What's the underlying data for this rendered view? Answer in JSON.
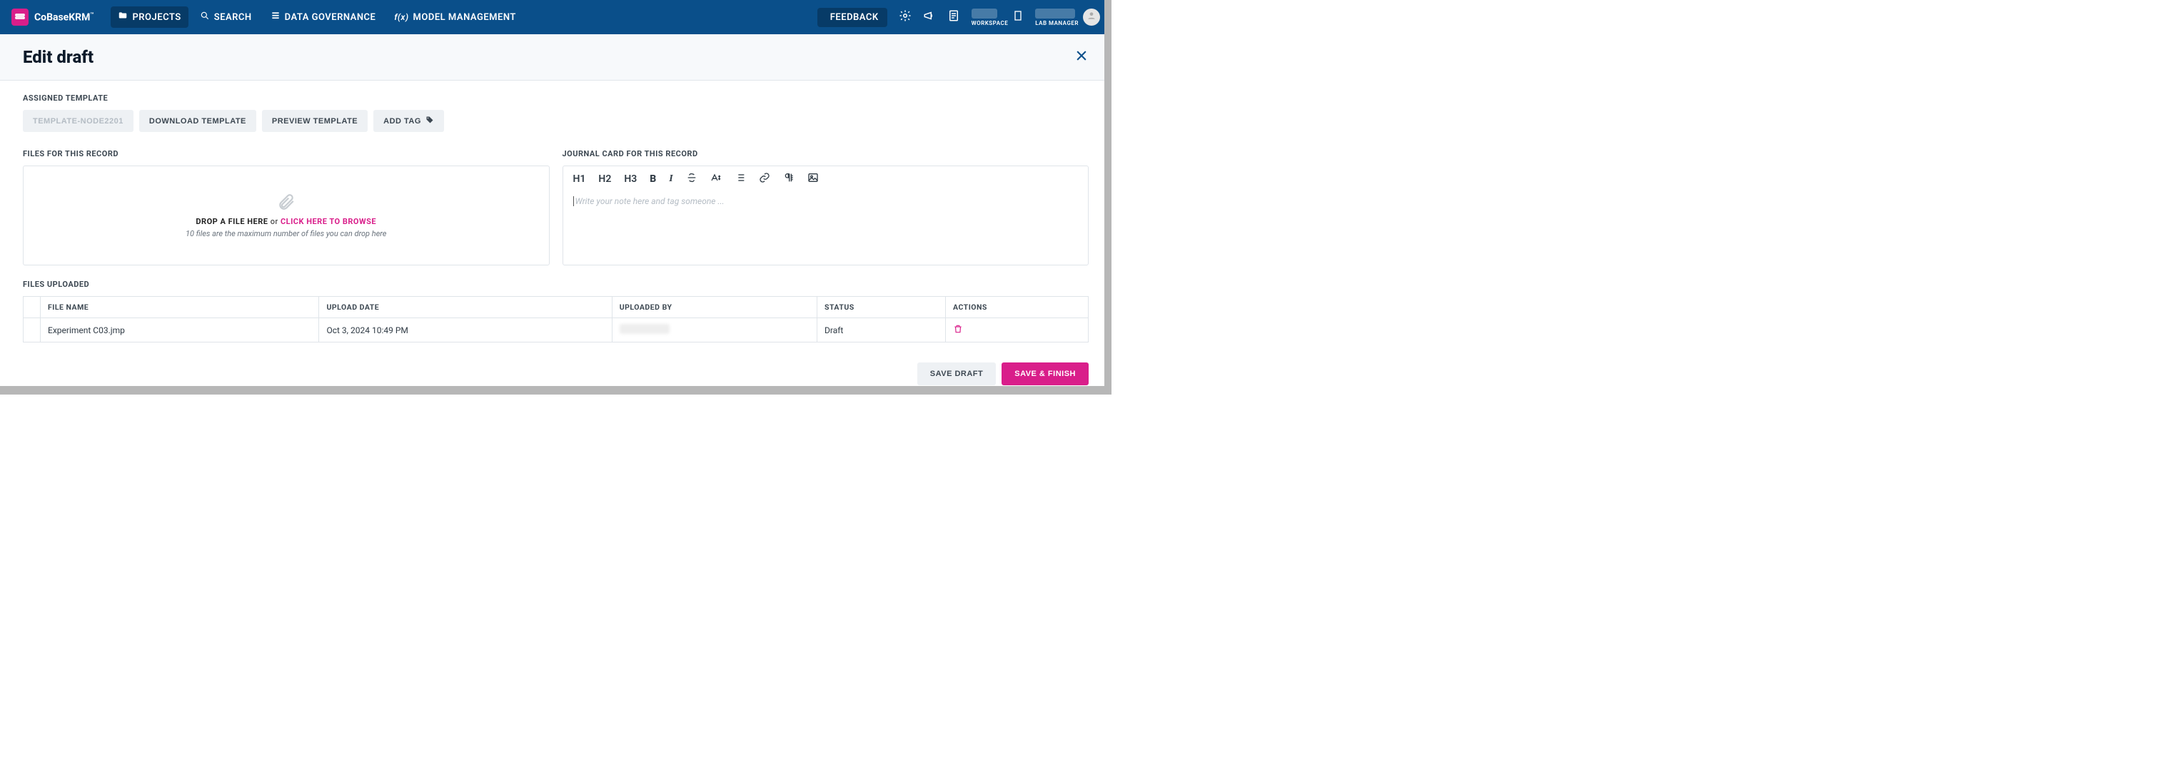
{
  "brand": {
    "name": "CoBaseKRM",
    "tm": "™"
  },
  "nav": {
    "items": [
      {
        "label": "PROJECTS",
        "icon": "folder-icon",
        "active": true
      },
      {
        "label": "SEARCH",
        "icon": "search-icon",
        "active": false
      },
      {
        "label": "DATA GOVERNANCE",
        "icon": "stack-icon",
        "active": false
      },
      {
        "label": "MODEL MANAGEMENT",
        "icon": "fx-icon",
        "active": false
      }
    ],
    "feedback": "FEEDBACK",
    "workspace_label": "WORKSPACE",
    "role_label": "LAB MANAGER"
  },
  "page": {
    "title": "Edit draft"
  },
  "template": {
    "section_label": "ASSIGNED TEMPLATE",
    "name_btn": "TEMPLATE-NODE2201",
    "download_btn": "DOWNLOAD TEMPLATE",
    "preview_btn": "PREVIEW TEMPLATE",
    "add_tag_btn": "ADD TAG"
  },
  "files_panel": {
    "section_label": "FILES FOR THIS RECORD",
    "drop_prefix": "DROP A FILE HERE",
    "drop_or": "or",
    "drop_link": "CLICK HERE TO BROWSE",
    "drop_sub": "10 files are the maximum number of files you can drop here"
  },
  "journal_panel": {
    "section_label": "JOURNAL CARD FOR THIS RECORD",
    "placeholder": "Write your note here and tag someone ...",
    "toolbar": {
      "h1": "H1",
      "h2": "H2",
      "h3": "H3"
    }
  },
  "uploaded": {
    "section_label": "FILES UPLOADED",
    "columns": {
      "file_name": "FILE NAME",
      "upload_date": "UPLOAD DATE",
      "uploaded_by": "UPLOADED BY",
      "status": "STATUS",
      "actions": "ACTIONS"
    },
    "rows": [
      {
        "file_name": "Experiment C03.jmp",
        "upload_date": "Oct 3, 2024 10:49 PM",
        "uploaded_by": "",
        "status": "Draft"
      }
    ]
  },
  "footer": {
    "save_draft": "SAVE DRAFT",
    "save_finish": "SAVE & FINISH"
  }
}
